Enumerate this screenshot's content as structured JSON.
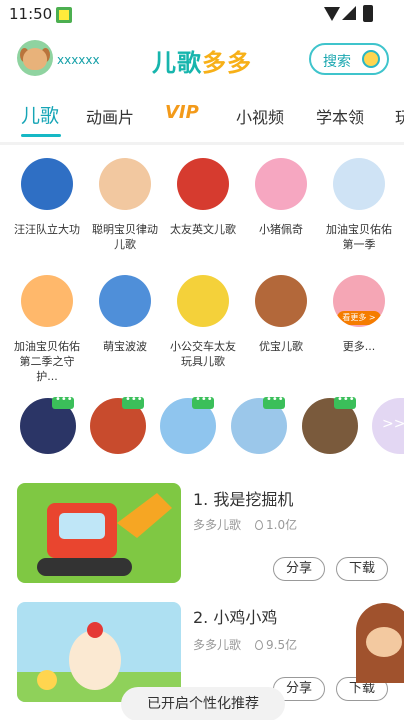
{
  "status_bar": {
    "time": "11:50"
  },
  "header": {
    "username": "xxxxxx",
    "logo_part1": "儿歌",
    "logo_part2": "多多",
    "search_label": "搜索"
  },
  "tabs": [
    {
      "label": "儿歌",
      "active": true
    },
    {
      "label": "动画片"
    },
    {
      "label": "VIP"
    },
    {
      "label": "小视频"
    },
    {
      "label": "学本领"
    },
    {
      "label": "玩"
    }
  ],
  "grid": {
    "row1": [
      {
        "label": "汪汪队立大功",
        "icon": "paw-patrol-dog",
        "color": "#2f6fc4"
      },
      {
        "label": "聪明宝贝律动儿歌",
        "icon": "baby-character",
        "color": "#f2c8a0"
      },
      {
        "label": "太友英文儿歌",
        "icon": "red-bus",
        "color": "#d63b2f"
      },
      {
        "label": "小猪佩奇",
        "icon": "pink-pig",
        "color": "#f6a7c1"
      },
      {
        "label": "加油宝贝佑佑第一季",
        "icon": "toddler",
        "color": "#cfe3f5"
      }
    ],
    "row2": [
      {
        "label": "加油宝贝佑佑第二季之守护...",
        "icon": "toddler-orange",
        "color": "#ffb86b"
      },
      {
        "label": "萌宝波波",
        "icon": "boy-character",
        "color": "#4f8fd9"
      },
      {
        "label": "小公交车太友玩具儿歌",
        "icon": "yellow-bus",
        "color": "#f4d13a"
      },
      {
        "label": "优宝儿歌",
        "icon": "fox-character",
        "color": "#b3683a"
      },
      {
        "label": "更多...",
        "icon": "pink-pig-more",
        "color": "#f5a6b5",
        "badge": "看更多 >"
      }
    ]
  },
  "characters": [
    {
      "icon": "robot-hero",
      "color": "#2b3566"
    },
    {
      "icon": "nezha",
      "color": "#c84b2d"
    },
    {
      "icon": "peppa",
      "color": "#8fc5ee"
    },
    {
      "icon": "elsa",
      "color": "#9bc7ea"
    },
    {
      "icon": "girl-portrait",
      "color": "#7a5a3c"
    }
  ],
  "more_arrow": ">>",
  "songs": [
    {
      "title": "1. 我是挖掘机",
      "artist": "多多儿歌",
      "plays": "1.0亿",
      "share": "分享",
      "download": "下载",
      "thumb_color": "#7fc843",
      "thumb_icon": "excavator"
    },
    {
      "title": "2. 小鸡小鸡",
      "artist": "多多儿歌",
      "plays": "9.5亿",
      "share": "分享",
      "download": "下载",
      "thumb_color": "#aee0f2",
      "thumb_icon": "chicken"
    }
  ],
  "toast": "已开启个性化推荐"
}
